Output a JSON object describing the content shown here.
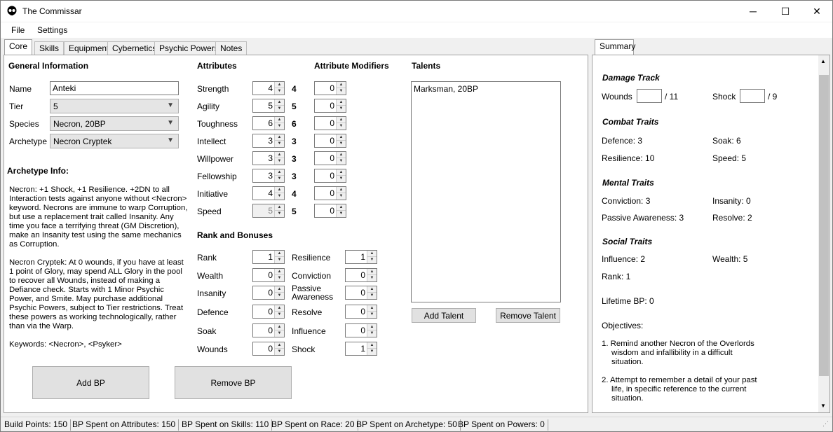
{
  "window": {
    "title": "The Commissar",
    "minimize": "─",
    "maximize": "☐",
    "close": "✕"
  },
  "menu": {
    "file": "File",
    "settings": "Settings"
  },
  "tabs": [
    "Core",
    "Skills",
    "Equipment",
    "Cybernetics",
    "Psychic Powers",
    "Notes"
  ],
  "summary_tab": "Summary",
  "general": {
    "heading": "General Information",
    "name_label": "Name",
    "name_value": "Anteki",
    "tier_label": "Tier",
    "tier_value": "5",
    "species_label": "Species",
    "species_value": "Necron, 20BP",
    "archetype_label": "Archetype",
    "archetype_value": "Necron Cryptek"
  },
  "archetype_info": {
    "heading": "Archetype Info:",
    "p1": [
      "Necron: +1 Shock, +1 Resilience. +2DN to all",
      "Interaction tests against anyone without <Necron>",
      "keyword. Necrons are immune to warp Corruption,",
      "but use a replacement trait called Insanity. Any",
      "time you face a terrifying threat (GM Discretion),",
      "make an Insanity test using the same mechanics",
      "as Corruption."
    ],
    "p2": [
      "Necron Cryptek: At 0 wounds, if you have at least",
      "1 point of Glory, may spend ALL Glory in the pool",
      "to recover all Wounds, instead of making a",
      "Defiance check. Starts with 1 Minor Psychic",
      "Power, and Smite. May purchase additional",
      "Psychic Powers, subject to Tier restrictions. Treat",
      "these powers as working technologically, rather",
      "than via the Warp."
    ],
    "keywords": "Keywords: <Necron>, <Psyker>"
  },
  "attributes": {
    "heading": "Attributes",
    "mod_heading": "Attribute Modifiers",
    "rows": [
      {
        "label": "Strength",
        "value": "4",
        "total": "4",
        "mod": "0"
      },
      {
        "label": "Agility",
        "value": "5",
        "total": "5",
        "mod": "0"
      },
      {
        "label": "Toughness",
        "value": "6",
        "total": "6",
        "mod": "0"
      },
      {
        "label": "Intellect",
        "value": "3",
        "total": "3",
        "mod": "0"
      },
      {
        "label": "Willpower",
        "value": "3",
        "total": "3",
        "mod": "0"
      },
      {
        "label": "Fellowship",
        "value": "3",
        "total": "3",
        "mod": "0"
      },
      {
        "label": "Initiative",
        "value": "4",
        "total": "4",
        "mod": "0"
      },
      {
        "label": "Speed",
        "value": "5",
        "total": "5",
        "mod": "0"
      }
    ]
  },
  "rank": {
    "heading": "Rank and Bonuses",
    "left": [
      {
        "label": "Rank",
        "value": "1"
      },
      {
        "label": "Wealth",
        "value": "0"
      },
      {
        "label": "Insanity",
        "value": "0"
      },
      {
        "label": "Defence",
        "value": "0"
      },
      {
        "label": "Soak",
        "value": "0"
      },
      {
        "label": "Wounds",
        "value": "0"
      }
    ],
    "right": [
      {
        "label": "Resilience",
        "value": "1"
      },
      {
        "label": "Conviction",
        "value": "0"
      },
      {
        "label": "Passive",
        "label2": "Awareness",
        "value": "0"
      },
      {
        "label": "Resolve",
        "value": "0"
      },
      {
        "label": "Influence",
        "value": "0"
      },
      {
        "label": "Shock",
        "value": "1"
      }
    ]
  },
  "talents": {
    "heading": "Talents",
    "items": [
      "Marksman, 20BP"
    ],
    "add": "Add Talent",
    "remove": "Remove Talent"
  },
  "bp": {
    "add": "Add BP",
    "remove": "Remove BP"
  },
  "summary": {
    "damage": {
      "heading": "Damage Track",
      "wounds": "Wounds",
      "wounds_max": "/ 11",
      "shock": "Shock",
      "shock_max": "/ 9"
    },
    "combat": {
      "heading": "Combat Traits",
      "defence": "Defence: 3",
      "soak": "Soak: 6",
      "resilience": "Resilience: 10",
      "speed": "Speed: 5"
    },
    "mental": {
      "heading": "Mental Traits",
      "conviction": "Conviction: 3",
      "insanity": "Insanity: 0",
      "passive": "Passive Awareness: 3",
      "resolve": "Resolve: 2"
    },
    "social": {
      "heading": "Social Traits",
      "influence": "Influence: 2",
      "wealth": "Wealth: 5",
      "rank": "Rank: 1"
    },
    "lifetime": "Lifetime BP: 0",
    "objectives_heading": "Objectives:",
    "obj1": [
      "1. Remind another Necron of the Overlords",
      "wisdom and infallibility in a difficult",
      "situation."
    ],
    "obj2": [
      "2. Attempt to remember a detail of your past",
      "life, in specific reference to the current",
      "situation."
    ]
  },
  "status": [
    "Build Points: 150",
    "BP Spent on Attributes: 150",
    "BP Spent on Skills: 110",
    "BP Spent on Race: 20",
    "BP Spent on Archetype: 50",
    "BP Spent on Powers: 0"
  ]
}
